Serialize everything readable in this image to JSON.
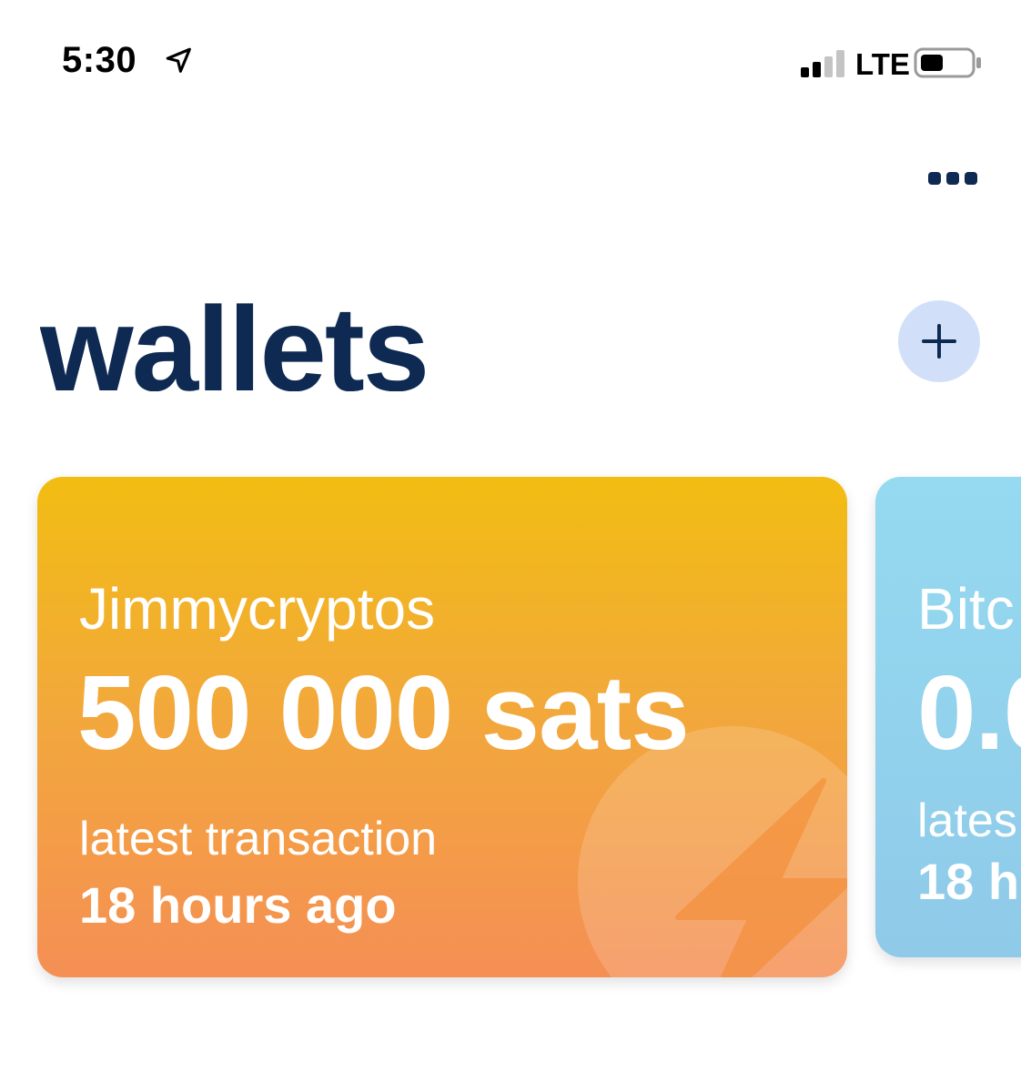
{
  "status_bar": {
    "time": "5:30",
    "network": "LTE",
    "icons": [
      "location-arrow-icon",
      "signal-bars-icon",
      "battery-icon"
    ]
  },
  "header": {
    "more_icon": "more-dots-icon",
    "title": "wallets",
    "add_icon": "plus-icon"
  },
  "wallets": [
    {
      "name": "Jimmycryptos",
      "balance": "500 000 sats",
      "latest_label": "latest transaction",
      "latest_value": "18 hours ago",
      "icon": "lightning-icon",
      "colors": {
        "top": "#f2bd12",
        "bottom": "#f58f55"
      }
    },
    {
      "name": "Bitc",
      "balance": "0.0",
      "latest_label": "lates",
      "latest_value": "18 h",
      "colors": {
        "top": "#95daf0",
        "bottom": "#8fcae9"
      }
    }
  ],
  "colors": {
    "title": "#0f2a52",
    "add_button_bg": "#d1e0f8",
    "text_on_card": "#ffffff"
  }
}
